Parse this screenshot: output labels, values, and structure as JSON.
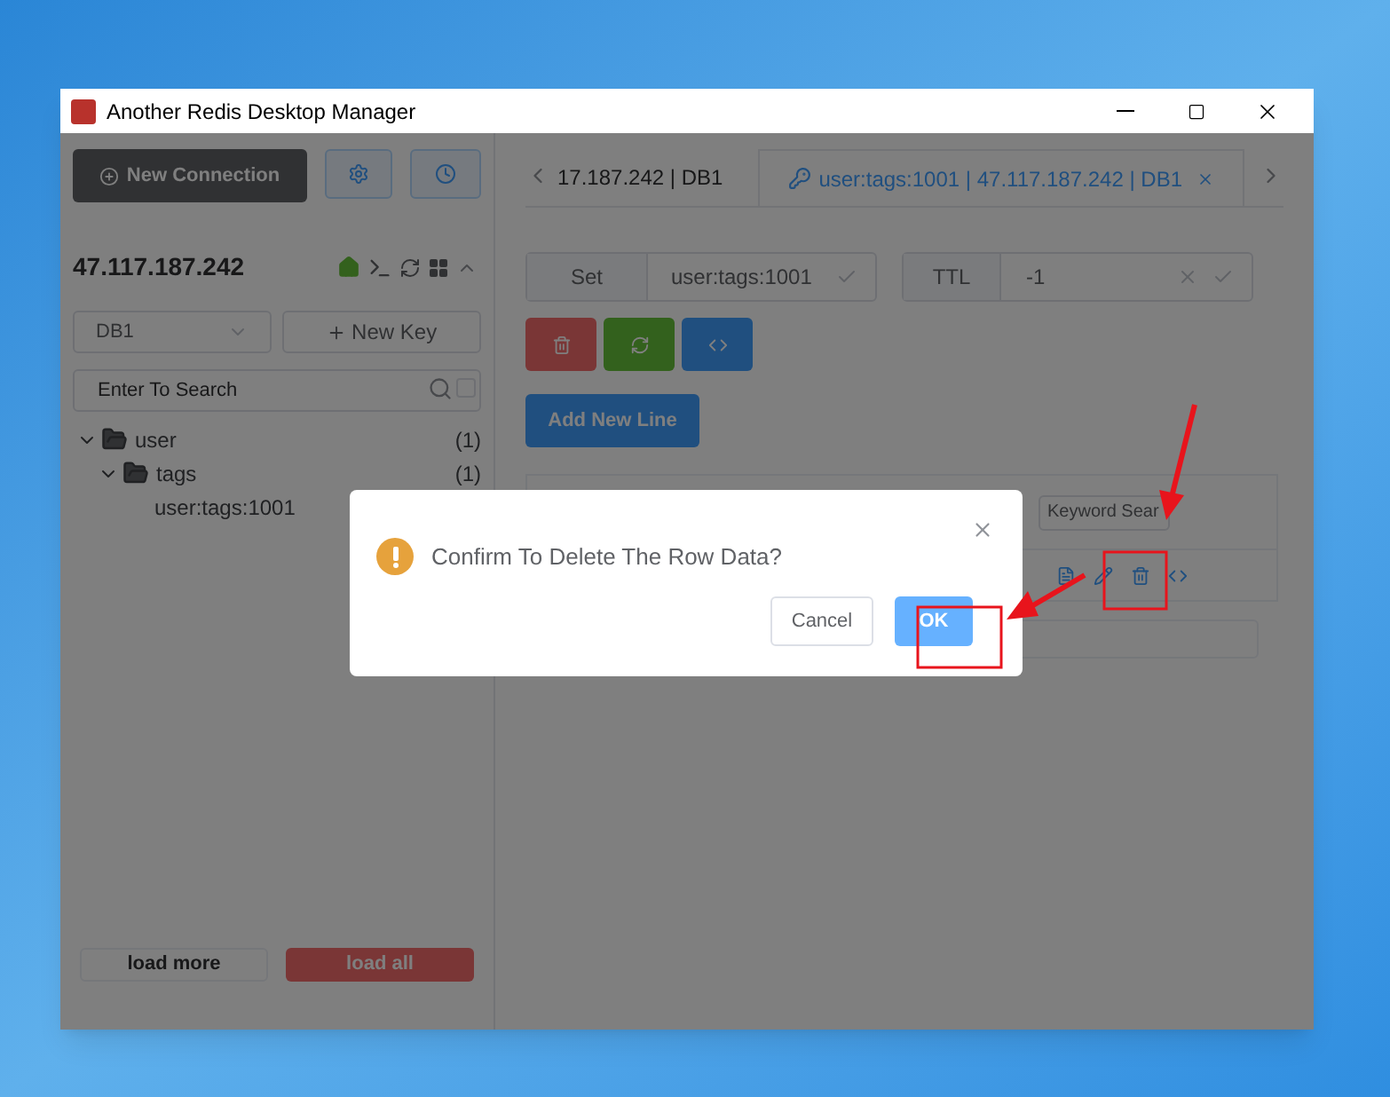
{
  "window": {
    "title": "Another Redis Desktop Manager"
  },
  "sidebar": {
    "new_connection": "New Connection",
    "host": "47.117.187.242",
    "db_select": "DB1",
    "new_key": "New Key",
    "search": {
      "placeholder": "Enter To Search",
      "checked": false
    },
    "tree": [
      {
        "label": "user",
        "count": "(1)",
        "expanded": true,
        "children": [
          {
            "label": "tags",
            "count": "(1)",
            "expanded": true,
            "children": [
              {
                "label": "user:tags:1001"
              }
            ]
          }
        ]
      }
    ],
    "load_more": "load more",
    "load_all": "load all"
  },
  "tabs": [
    {
      "label": "17.187.242 | DB1",
      "selected": false,
      "closable": false
    },
    {
      "label": "user:tags:1001 | 47.117.187.242 | DB1",
      "selected": true,
      "closable": true
    }
  ],
  "key_editor": {
    "type": "Set",
    "key": "user:tags:1001",
    "ttl_label": "TTL",
    "ttl": "-1",
    "add_line": "Add New Line",
    "keyword_search": {
      "placeholder": "Keyword Sear"
    }
  },
  "dialog": {
    "message": "Confirm To Delete The Row Data?",
    "cancel": "Cancel",
    "ok": "OK"
  }
}
